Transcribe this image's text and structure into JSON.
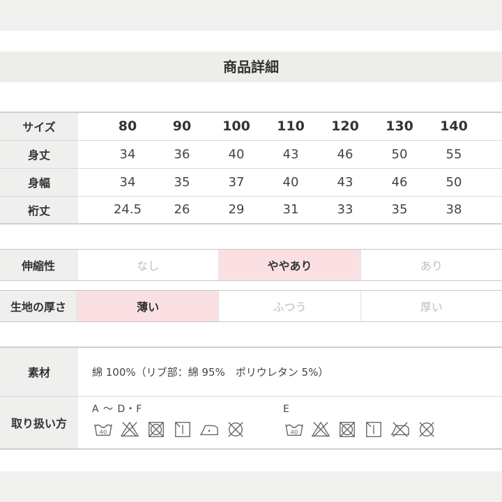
{
  "title": "商品詳細",
  "size_table": {
    "header_label": "サイズ",
    "sizes": [
      "80",
      "90",
      "100",
      "110",
      "120",
      "130",
      "140"
    ],
    "rows": [
      {
        "label": "身丈",
        "values": [
          "34",
          "36",
          "40",
          "43",
          "46",
          "50",
          "55"
        ]
      },
      {
        "label": "身幅",
        "values": [
          "34",
          "35",
          "37",
          "40",
          "43",
          "46",
          "50"
        ]
      },
      {
        "label": "裄丈",
        "values": [
          "24.5",
          "26",
          "29",
          "31",
          "33",
          "35",
          "38"
        ]
      }
    ]
  },
  "stretch": {
    "label": "伸縮性",
    "options": [
      "なし",
      "ややあり",
      "あり"
    ],
    "selected": "ややあり"
  },
  "thickness": {
    "label": "生地の厚さ",
    "options": [
      "薄い",
      "ふつう",
      "厚い"
    ],
    "selected": "薄い"
  },
  "material": {
    "label": "素材",
    "value": "綿 100%（リブ部：綿 95%　ポリウレタン 5%）"
  },
  "care": {
    "label": "取り扱い方",
    "groups": [
      {
        "caption": "A ～ D・F",
        "icons": [
          "wash-40-icon",
          "no-bleach-icon",
          "no-tumble-dry-icon",
          "line-dry-shade-icon",
          "iron-low-icon",
          "no-dry-clean-icon"
        ]
      },
      {
        "caption": "E",
        "icons": [
          "wash-40-icon",
          "no-bleach-icon",
          "no-tumble-dry-icon",
          "line-dry-shade-icon",
          "no-iron-icon",
          "no-dry-clean-icon"
        ]
      }
    ],
    "wash_temp": "40"
  }
}
